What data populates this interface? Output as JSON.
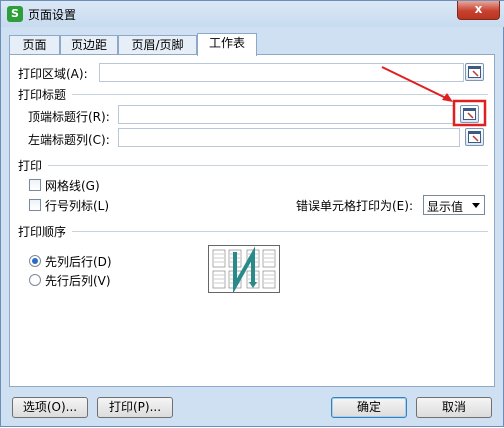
{
  "window": {
    "title": "页面设置",
    "close_label": "x",
    "app_icon_letter": "S"
  },
  "tabs": [
    {
      "label": "页面"
    },
    {
      "label": "页边距"
    },
    {
      "label": "页眉/页脚"
    },
    {
      "label": "工作表"
    }
  ],
  "print_area": {
    "label": "打印区域(A):",
    "value": ""
  },
  "print_titles": {
    "section": "打印标题",
    "top_rows_label": "顶端标题行(R):",
    "top_rows_value": "",
    "left_cols_label": "左端标题列(C):",
    "left_cols_value": ""
  },
  "print": {
    "section": "打印",
    "gridlines_label": "网格线(G)",
    "gridlines_checked": false,
    "rowcol_headers_label": "行号列标(L)",
    "rowcol_headers_checked": false,
    "cell_errors_label": "错误单元格打印为(E):",
    "cell_errors_value": "显示值"
  },
  "print_order": {
    "section": "打印顺序",
    "down_then_over_label": "先列后行(D)",
    "over_then_down_label": "先行后列(V)",
    "selected": "down_then_over"
  },
  "buttons": {
    "options": "选项(O)...",
    "print": "打印(P)...",
    "ok": "确定",
    "cancel": "取消"
  },
  "colors": {
    "annotation_red": "#e02020",
    "dialog_bg": "#cfe0f2",
    "order_arrow": "#2a8a8a"
  }
}
